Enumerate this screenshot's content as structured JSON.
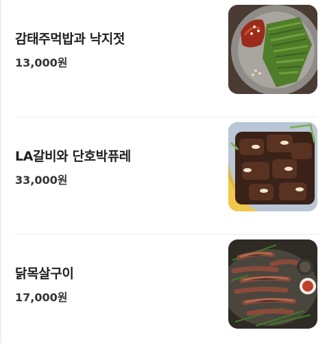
{
  "menu": {
    "items": [
      {
        "name": "감태주먹밥과 낙지젓",
        "price": "13,000원",
        "image": "seaweed-riceball-octopus-photo"
      },
      {
        "name": "LA갈비와 단호박퓨레",
        "price": "33,000원",
        "image": "la-galbi-pumpkin-puree-photo"
      },
      {
        "name": "닭목살구이",
        "price": "17,000원",
        "image": "grilled-chicken-neck-photo"
      }
    ]
  }
}
